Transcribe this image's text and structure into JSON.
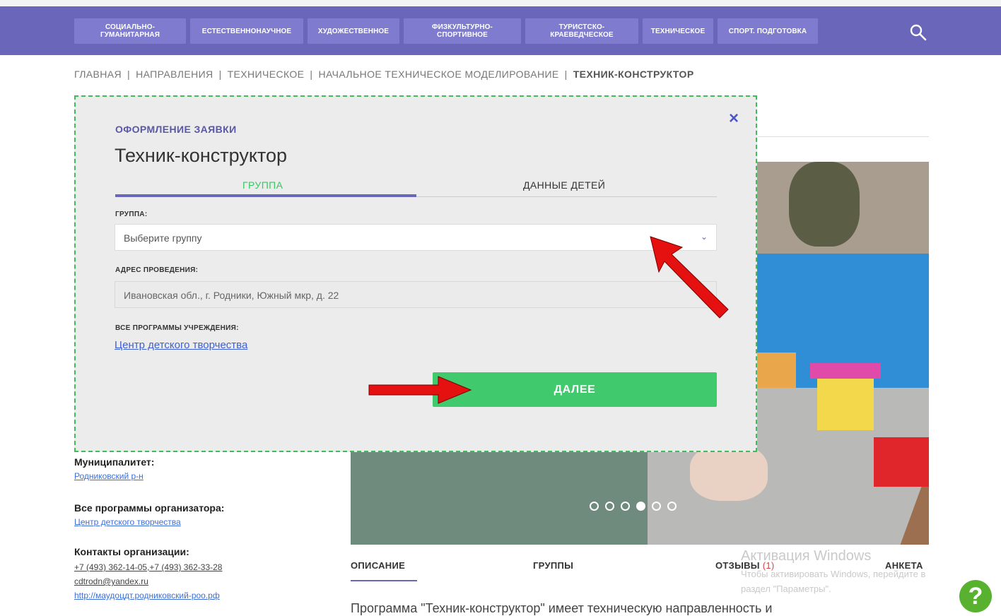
{
  "nav": {
    "items": [
      "СОЦИАЛЬНО-\nГУМАНИТАРНАЯ",
      "ЕСТЕСТВЕННОНАУЧНОЕ",
      "ХУДОЖЕСТВЕННОЕ",
      "ФИЗКУЛЬТУРНО-\nСПОРТИВНОЕ",
      "ТУРИСТСКО-\nКРАЕВЕДЧЕСКОЕ",
      "ТЕХНИЧЕСКОЕ",
      "СПОРТ. ПОДГОТОВКА"
    ],
    "search_icon": "search-icon"
  },
  "breadcrumb": [
    "ГЛАВНАЯ",
    "НАПРАВЛЕНИЯ",
    "ТЕХНИЧЕСКОЕ",
    "НАЧАЛЬНОЕ ТЕХНИЧЕСКОЕ МОДЕЛИРОВАНИЕ",
    "ТЕХНИК-КОНСТРУКТОР"
  ],
  "modal": {
    "overline": "ОФОРМЛЕНИЕ ЗАЯВКИ",
    "title": "Техник-конструктор",
    "tabs": [
      "ГРУППА",
      "ДАННЫЕ ДЕТЕЙ"
    ],
    "group_label": "ГРУППА:",
    "group_placeholder": "Выберите группу",
    "address_label": "АДРЕС ПРОВЕДЕНИЯ:",
    "address_value": "Ивановская обл., г. Родники, Южный мкр, д. 22",
    "programs_label": "ВСЕ ПРОГРАММЫ УЧРЕЖДЕНИЯ:",
    "programs_link": "Центр детского творчества",
    "next_button": "ДАЛЕЕ",
    "close_icon": "×"
  },
  "sidebar": {
    "municipality_label": "Муниципалитет:",
    "municipality_value": "Родниковский р-н",
    "all_programs_label": "Все программы организатора:",
    "all_programs_value": "Центр детского творчества",
    "contacts_label": "Контакты организации:",
    "phones": "+7 (493) 362-14-05,+7 (493) 362-33-28",
    "email": "cdtrodn@yandex.ru",
    "website": "http://маудоцдт.родниковский-роо.рф"
  },
  "content_tabs": {
    "description": "ОПИСАНИЕ",
    "groups": "ГРУППЫ",
    "reviews": "ОТЗЫВЫ",
    "reviews_count": "(1)",
    "form": "АНКЕТА"
  },
  "description_text": "Программа \"Техник-конструктор\" имеет техническую направленность и",
  "windows_watermark": {
    "title": "Активация Windows",
    "line1": "Чтобы активировать Windows, перейдите в",
    "line2": "раздел \"Параметры\"."
  },
  "help_button": "?",
  "colors": {
    "brand": "#6a66b9",
    "accent_green": "#40c96d",
    "arrow_red": "#e51010"
  }
}
